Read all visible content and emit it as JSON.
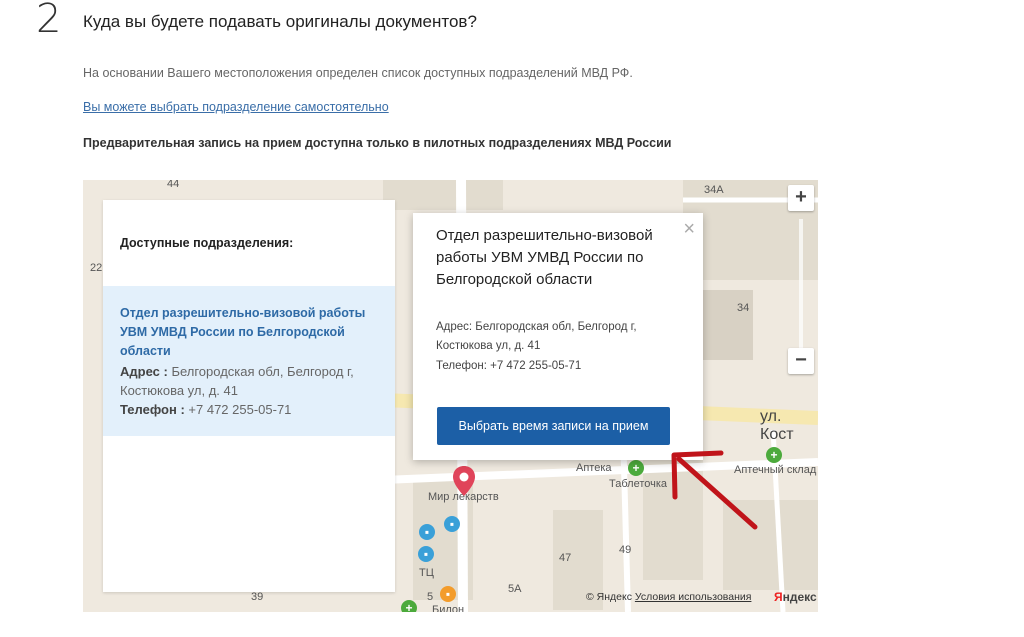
{
  "step": {
    "number": "2",
    "title": "Куда вы будете подавать оригиналы документов?"
  },
  "info_text": "На основании Вашего местоположения определен список доступных подразделений МВД РФ.",
  "choose_link": "Вы можете выбрать подразделение самостоятельно",
  "pilot_note": "Предварительная запись на прием доступна только в пилотных подразделениях МВД России",
  "list": {
    "heading": "Доступные подразделения:",
    "items": [
      {
        "name": "Отдел разрешительно-визовой работы УВМ УМВД России по Белгородской области",
        "address_label": "Адрес :",
        "address": "Белгородская обл, Белгород г, Костюкова ул, д. 41",
        "phone_label": "Телефон :",
        "phone": "+7 472 255-05-71"
      }
    ]
  },
  "popup": {
    "title": "Отдел разрешительно-визовой работы УВМ УМВД России по Белгородской области",
    "address": "Адрес: Белгородская обл, Белгород г, Костюкова ул, д. 41",
    "phone": "Телефон: +7 472 255-05-71",
    "button": "Выбрать время записи на прием",
    "close": "×"
  },
  "map": {
    "zoom_in": "+",
    "zoom_out": "−",
    "labels": {
      "l44": "44",
      "l34a": "34А",
      "l22": "22",
      "l34": "34",
      "street": "ул. Кост",
      "apteka": "Аптека",
      "apteka_sklad": "Аптечный склад",
      "tabletochka": "Таблеточка",
      "mir_lekarstv": "Мир лекарств",
      "tc": "ТЦ",
      "l47": "47",
      "l49": "49",
      "l5a": "5А",
      "l39": "39",
      "l5": "5",
      "bilon": "Билон"
    },
    "copyright": "© Яндекс",
    "terms": "Условия использования",
    "logo_y": "Я",
    "logo_rest": "ндекс"
  },
  "colors": {
    "accent": "#1c5fa6",
    "link": "#2e6aa6",
    "highlight": "#e3f0fb",
    "pin": "#e0445a",
    "arrow": "#c0141a"
  }
}
